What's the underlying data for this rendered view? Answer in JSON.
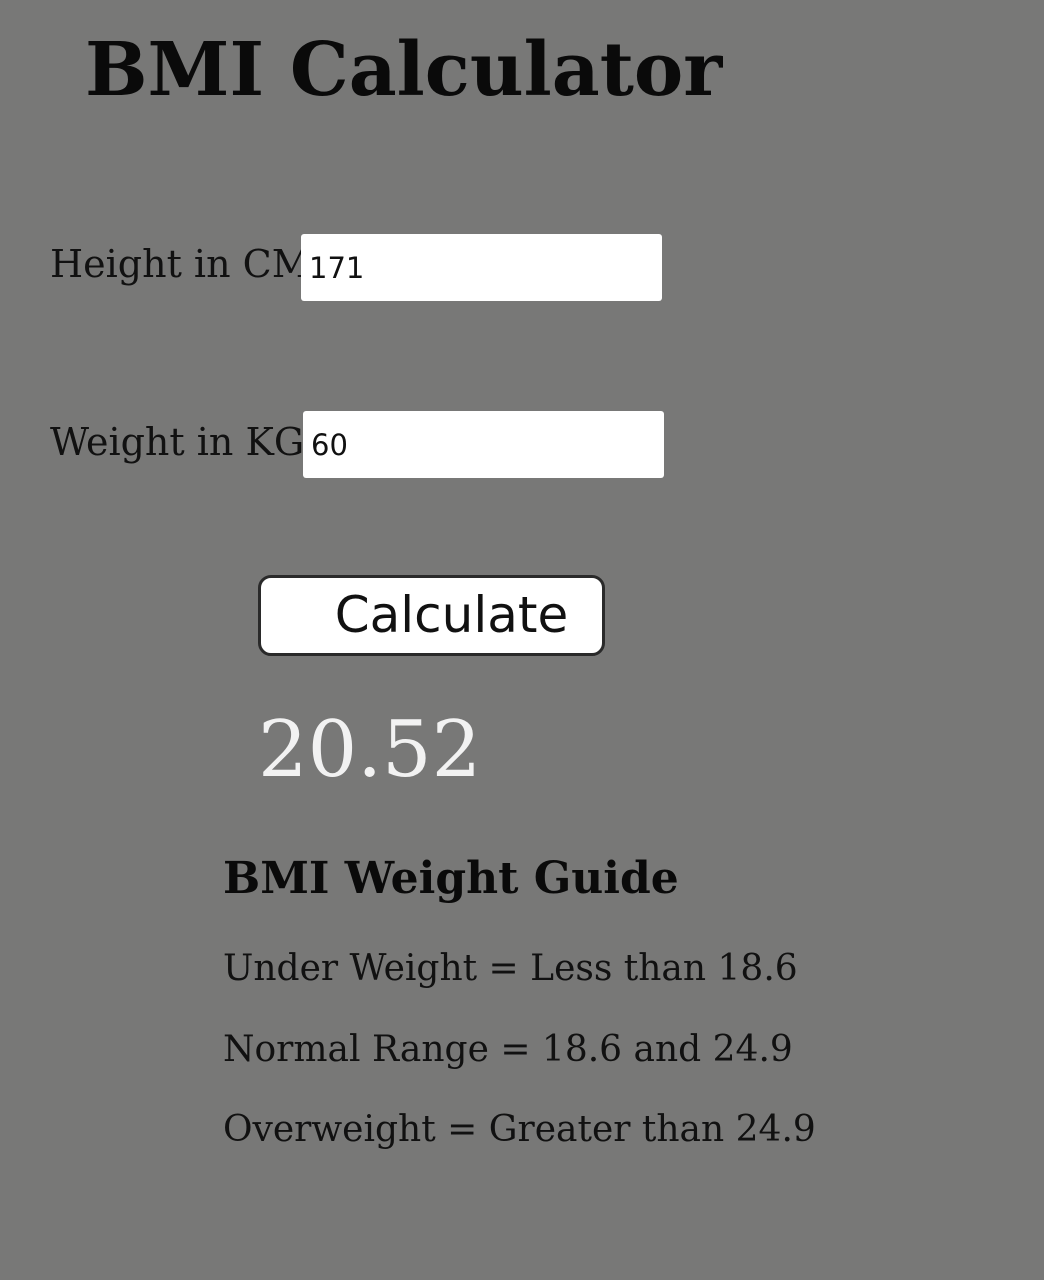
{
  "app": {
    "title": "BMI Calculator"
  },
  "form": {
    "height_label": "Height in CM:",
    "height_value": "171",
    "weight_label": "Weight in KG:",
    "weight_value": "60",
    "calculate_label": "Calculate"
  },
  "result": {
    "value": "20.52"
  },
  "guide": {
    "title": "BMI Weight Guide",
    "lines": [
      "Under Weight = Less than 18.6",
      "Normal Range = 18.6 and 24.9",
      "Overweight = Greater than 24.9"
    ]
  },
  "colors": {
    "background": "#787877",
    "result_text": "#f2f2f2",
    "input_background": "#ffffff"
  }
}
